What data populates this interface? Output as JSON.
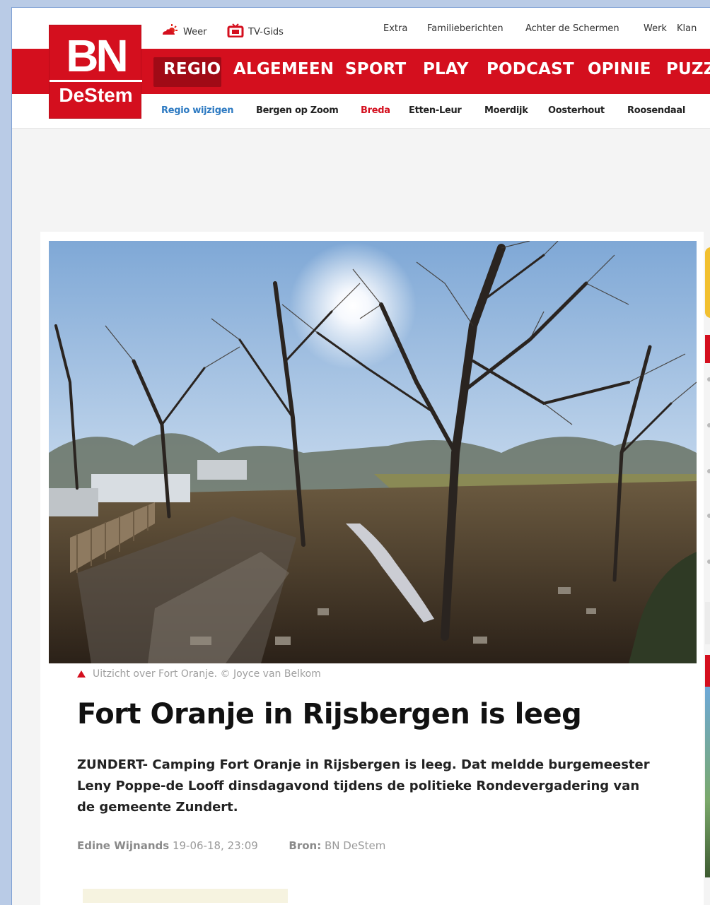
{
  "logo": {
    "line1": "BN",
    "line2": "DeStem"
  },
  "topbar": {
    "weather_label": "Weer",
    "tvguide_label": "TV-Gids",
    "links": [
      "Extra",
      "Familieberichten",
      "Achter de Schermen",
      "Werk",
      "Klan"
    ]
  },
  "nav": {
    "items": [
      "REGIO",
      "ALGEMEEN",
      "SPORT",
      "PLAY",
      "PODCAST",
      "OPINIE",
      "PUZZ"
    ]
  },
  "regions": {
    "edit_label": "Regio wijzigen",
    "items": [
      "Bergen op Zoom",
      "Breda",
      "Etten-Leur",
      "Moerdijk",
      "Oosterhout",
      "Roosendaal"
    ],
    "current": "Breda"
  },
  "article": {
    "caption": "Uitzicht over Fort Oranje. © Joyce van Belkom",
    "title": "Fort Oranje in Rijsbergen is leeg",
    "lead": "ZUNDERT- Camping Fort Oranje in Rijsbergen is leeg. Dat meldde burgemeester Leny Poppe-de Looff dinsdagavond tijdens de politieke Rondevergadering van de gemeente Zundert.",
    "author": "Edine Wijnands",
    "datetime": "19-06-18, 23:09",
    "source_label": "Bron:",
    "source": "BN DeStem"
  },
  "colors": {
    "brand_red": "#d40f1e",
    "link_blue": "#2d7ac2"
  }
}
